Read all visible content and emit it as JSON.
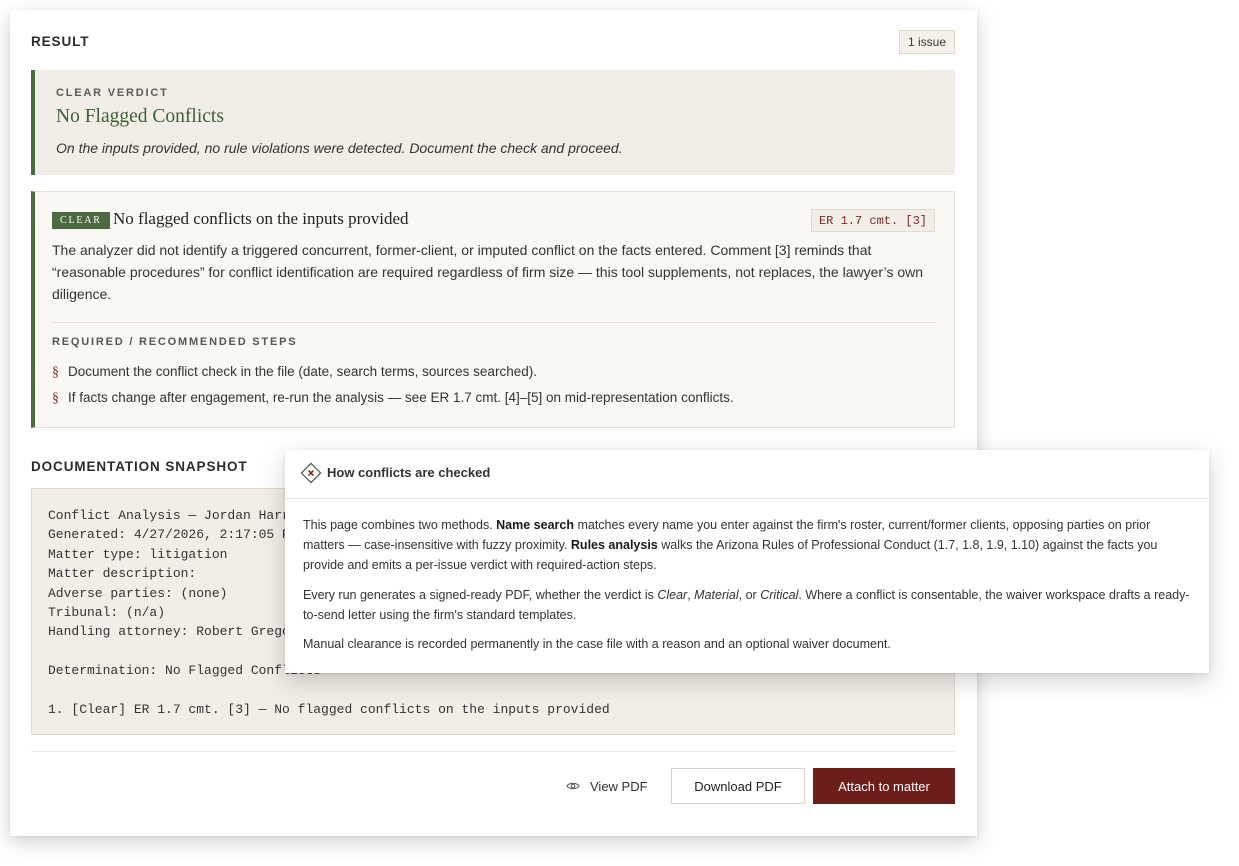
{
  "result": {
    "title": "RESULT",
    "issue_count": "1 issue"
  },
  "verdict": {
    "kicker": "CLEAR VERDICT",
    "heading": "No Flagged Conflicts",
    "description": "On the inputs provided, no rule violations were detected. Document the check and proceed."
  },
  "issue": {
    "status": "CLEAR",
    "title": "No flagged conflicts on the inputs provided",
    "reference": "ER 1.7 cmt. [3]",
    "body": "The analyzer did not identify a triggered concurrent, former-client, or imputed conflict on the facts entered. Comment [3] reminds that “reasonable procedures” for conflict identification are required regardless of firm size — this tool supplements, not replaces, the lawyer’s own diligence.",
    "steps_title": "REQUIRED / RECOMMENDED STEPS",
    "step_marker": "§",
    "steps": [
      "Document the conflict check in the file (date, search terms, sources searched).",
      "If facts change after engagement, re-run the analysis — see ER 1.7 cmt. [4]–[5] on mid-representation conflicts."
    ]
  },
  "documentation": {
    "title": "DOCUMENTATION SNAPSHOT",
    "lines": [
      "Conflict Analysis — Jordan Harr",
      "Generated: 4/27/2026, 2:17:05 P",
      "Matter type: litigation",
      "Matter description:",
      "Adverse parties: (none)",
      "Tribunal: (n/a)",
      "Handling attorney: Robert Grego",
      "",
      "Determination: No Flagged Conflicts",
      "",
      "1. [Clear] ER 1.7 cmt. [3] — No flagged conflicts on the inputs provided"
    ]
  },
  "actions": {
    "view_pdf": "View PDF",
    "download_pdf": "Download PDF",
    "attach": "Attach to matter"
  },
  "popover": {
    "title": "How conflicts are checked",
    "p1": {
      "a": "This page combines two methods. ",
      "b": "Name search",
      "c": " matches every name you enter against the firm's roster, current/former clients, opposing parties on prior matters — case-insensitive with fuzzy proximity. ",
      "d": "Rules analysis",
      "e": " walks the Arizona Rules of Professional Conduct (1.7, 1.8, 1.9, 1.10) against the facts you provide and emits a per-issue verdict with required-action steps."
    },
    "p2": {
      "a": "Every run generates a signed-ready PDF, whether the verdict is ",
      "b": "Clear",
      "c": ", ",
      "d": "Material",
      "e": ", or ",
      "f": "Critical",
      "g": ". Where a conflict is consentable, the waiver workspace drafts a ready-to-send letter using the firm's standard templates."
    },
    "p3": "Manual clearance is recorded permanently in the case file with a reason and an optional waiver document."
  },
  "colors": {
    "accent_green": "#4c6a3f",
    "accent_maroon": "#6d1d1a",
    "panel_beige": "#f1eee7"
  },
  "icons": {
    "view": "eye-icon",
    "info": "diamond-x-icon"
  }
}
